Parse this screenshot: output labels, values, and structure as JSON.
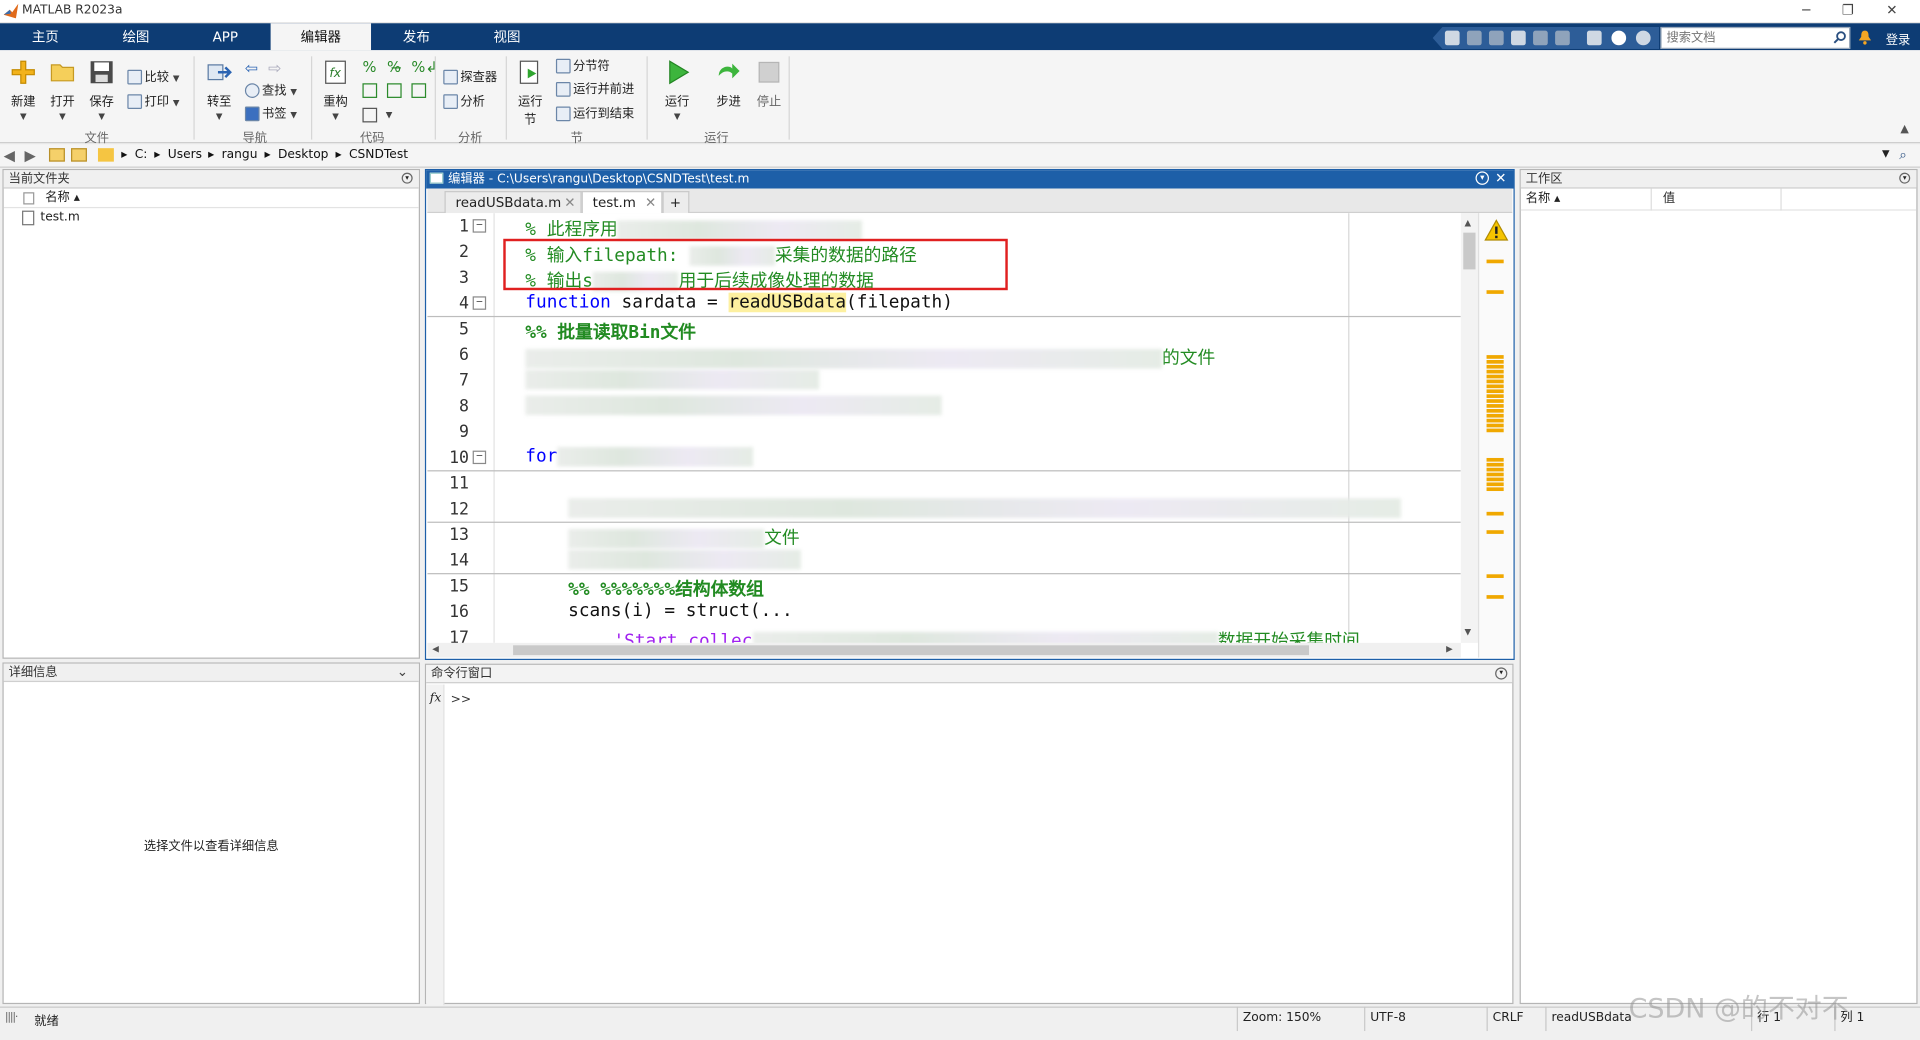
{
  "app": {
    "title": "MATLAB R2023a"
  },
  "window_controls": {
    "minimize": "─",
    "restore": "❐",
    "close": "✕"
  },
  "main_tabs": [
    "主页",
    "绘图",
    "APP",
    "编辑器",
    "发布",
    "视图"
  ],
  "active_tab": "编辑器",
  "search": {
    "placeholder": "搜索文档"
  },
  "login": "登录",
  "ribbon": {
    "file": {
      "label": "文件",
      "new": "新建",
      "open": "打开",
      "save": "保存",
      "compare": "比较",
      "print": "打印"
    },
    "navigate": {
      "label": "导航",
      "goto": "转至",
      "find": "查找",
      "bookmark": "书签"
    },
    "code": {
      "label": "代码",
      "refactor": "重构"
    },
    "analyze": {
      "label": "分析",
      "profiler": "探查器",
      "analyze": "分析"
    },
    "section": {
      "label": "节",
      "run_section_line1": "运行",
      "run_section_line2": "节",
      "section_break": "分节符",
      "run_advance": "运行并前进",
      "run_to_end": "运行到结束"
    },
    "run": {
      "label": "运行",
      "run": "运行",
      "step": "步进",
      "stop": "停止"
    }
  },
  "address": {
    "crumbs": [
      "C:",
      "Users",
      "rangu",
      "Desktop",
      "CSNDTest"
    ]
  },
  "current_folder": {
    "title": "当前文件夹",
    "column": "名称 ▴",
    "files": [
      "test.m"
    ]
  },
  "details": {
    "title": "详细信息",
    "message": "选择文件以查看详细信息"
  },
  "editor": {
    "title": "编辑器 - C:\\Users\\rangu\\Desktop\\CSNDTest\\test.m",
    "tabs": [
      "readUSBdata.m",
      "test.m"
    ],
    "add_tab": "+",
    "line_numbers": [
      "1",
      "2",
      "3",
      "4",
      "5",
      "6",
      "7",
      "8",
      "9",
      "10",
      "11",
      "12",
      "13",
      "14",
      "15",
      "16",
      "17"
    ],
    "lines": {
      "l1": "% 此程序用",
      "l2": "% 输入filepath: ",
      "l2b": "采集的数据的路径",
      "l3": "% 输出s",
      "l3b": "用于后续成像处理的数据",
      "l4_kw": "function",
      "l4_a": " sardata = ",
      "l4_fn": "readUSBdata",
      "l4_b": "(filepath)",
      "l5": "%% 批量读取Bin文件",
      "l6_tail": "的文件",
      "l10_kw": "for",
      "l13_tail": "文件",
      "l15": "%% %%%%%%%结构体数组",
      "l16": "scans(i) = struct(...",
      "l17": "'Start collec",
      "l17_tail": "数据开始采集时间"
    }
  },
  "command_window": {
    "title": "命令行窗口",
    "fx": "fx",
    "prompt": ">>"
  },
  "workspace": {
    "title": "工作区",
    "col_name": "名称 ▴",
    "col_value": "值"
  },
  "status": {
    "ready": "就绪",
    "zoom": "Zoom: 150%",
    "encoding": "UTF-8",
    "eol": "CRLF",
    "function": "readUSBdata",
    "row": "行 1",
    "col": "列 1"
  },
  "watermark": "CSDN @的不对不",
  "colors": {
    "tabbar": "#0d3c74",
    "editor_header": "#1d5fa8",
    "comment": "#228b22",
    "keyword": "#0000ff",
    "warning": "#f0a800",
    "annotation_box": "#e02020"
  }
}
